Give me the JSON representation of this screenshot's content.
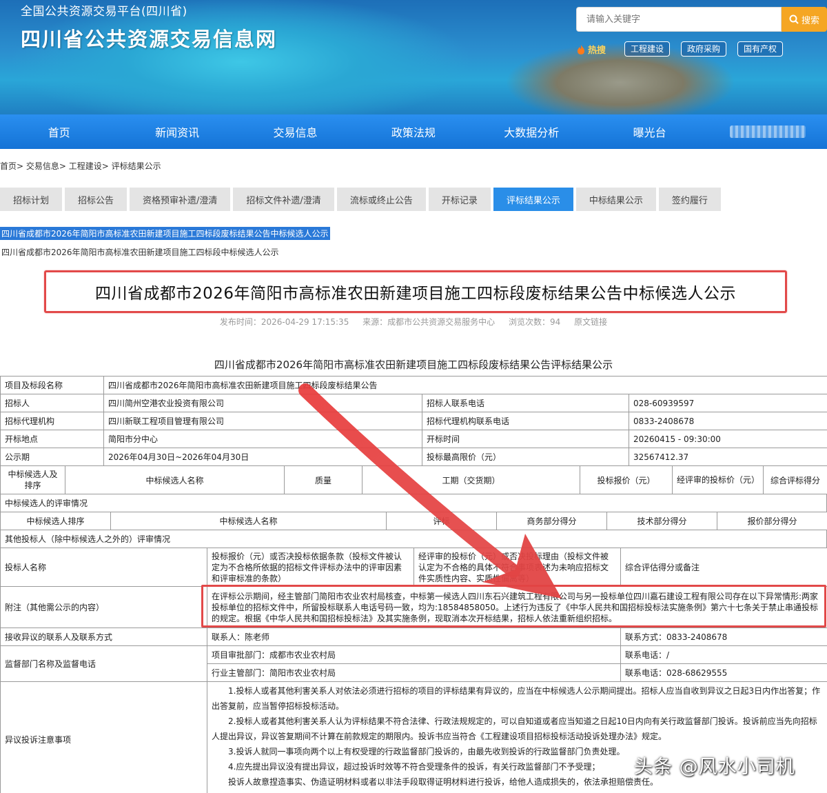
{
  "header": {
    "sub_title": "全国公共资源交易平台(四川省)",
    "site_title": "四川省公共资源交易信息网",
    "search_placeholder": "请输入关键字",
    "search_label": "搜索",
    "hot_label": "热搜",
    "hot_tags": [
      "工程建设",
      "政府采购",
      "国有产权"
    ]
  },
  "nav": [
    "首页",
    "新闻资讯",
    "交易信息",
    "政策法规",
    "大数据分析",
    "曝光台"
  ],
  "breadcrumb": "首页> 交易信息> 工程建设> 评标结果公示",
  "tabs": [
    "招标计划",
    "招标公告",
    "资格预审补遗/澄清",
    "招标文件补遗/澄清",
    "流标或终止公告",
    "开标记录",
    "评标结果公示",
    "中标结果公示",
    "签约履行"
  ],
  "active_tab": "评标结果公示",
  "highlight_title": "四川省成都市2026年简阳市高标准农田新建项目施工四标段废标结果公告中标候选人公示",
  "sub_title": "四川省成都市2026年简阳市高标准农田新建项目施工四标段中标候选人公示",
  "main_title": "四川省成都市2026年简阳市高标准农田新建项目施工四标段废标结果公告中标候选人公示",
  "meta": {
    "publish_time": "发布时间：2026-04-29 17:15:35",
    "source": "来源：成都市公共资源交易服务中心",
    "views": "浏览次数：94",
    "original_link": "原文链接"
  },
  "result_title": "四川省成都市2026年简阳市高标准农田新建项目施工四标段废标结果公告评标结果公示",
  "info": {
    "project_label": "项目及标段名称",
    "project_value": "四川省成都市2026年简阳市高标准农田新建项目施工四标段废标结果公告",
    "tenderer_label": "招标人",
    "tenderer_value": "四川简州空港农业投资有限公司",
    "tenderer_phone_label": "招标人联系电话",
    "tenderer_phone_value": "028-60939597",
    "agency_label": "招标代理机构",
    "agency_value": "四川新联工程项目管理有限公司",
    "agency_phone_label": "招标代理机构联系电话",
    "agency_phone_value": "0833-2408678",
    "open_place_label": "开标地点",
    "open_place_value": "简阳市分中心",
    "open_time_label": "开标时间",
    "open_time_value": "20260415 - 09:30:00",
    "notice_period_label": "公示期",
    "notice_period_value": "2026年04月30日~2026年04月30日",
    "max_price_label": "投标最高限价（元）",
    "max_price_value": "32567412.37"
  },
  "candidate_header": [
    "中标候选人及排序",
    "中标候选人名称",
    "质量",
    "工期（交货期）",
    "投标报价（元）",
    "经评审的投标价（元）",
    "综合评标得分"
  ],
  "review_section": "中标候选人的评审情况",
  "review_header": [
    "中标候选人排序",
    "中标候选人名称",
    "评标",
    "商务部分得分",
    "技术部分得分",
    "报价部分得分"
  ],
  "other_section": "其他投标人（除中标候选人之外的）评审情况",
  "other_header": {
    "name": "投标人名称",
    "price": "投标报价（元）或否决投标依据条款（投标文件被认定为不合格所依据的招标文件评标办法中的评审因素和评审标准的条款）",
    "reason": "经评审的投标价（元）或否决投标理由（投标文件被认定为不合格的具体不符合事项表述为未响应招标文件实质性内容、实质性偏离等）",
    "score": "综合评估得分或备注"
  },
  "notes": {
    "label": "附注（其他需公示的内容）",
    "text": "在评标公示期间，经主管部门简阳市农业农村局核查，中标第一候选人四川东石兴建筑工程有限公司与另一投标单位四川嘉石建设工程有限公司存在以下异常情形:两家投标单位的招标文件中，所留投标联系人电话号码一致，均为:18584858050。上述行为违反了《中华人民共和国招标投标法实施条例》第六十七条关于禁止串通投标的规定。根据《中华人民共和国招标投标法》及其实施条例，现取消本次开标结果，招标人依法重新组织招标。"
  },
  "objection": {
    "label": "接收异议的联系人及联系方式",
    "contact": "联系人：陈老师",
    "phone": "联系方式：0833-2408678"
  },
  "supervision": {
    "label": "监督部门名称及监督电话",
    "approve": "项目审批部门：成都市农业农村局",
    "approve_phone": "联系电话：/",
    "industry": "行业主管部门：简阳市农业农村局",
    "industry_phone": "联系电话：028-68629555"
  },
  "complaint": {
    "label": "异议投诉注意事项",
    "items": [
      "1.投标人或者其他利害关系人对依法必须进行招标的项目的评标结果有异议的，应当在中标候选人公示期间提出。招标人应当自收到异议之日起3日内作出答复；作出答复前，应当暂停招标投标活动。",
      "2.投标人或者其他利害关系人认为评标结果不符合法律、行政法规规定的，可以自知道或者应当知道之日起10日内向有关行政监督部门投诉。投诉前应当先向招标人提出异议，异议答复期间不计算在前款规定的期限内。投诉书应当符合《工程建设项目招标投标活动投诉处理办法》规定。",
      "3.投诉人就同一事项向两个以上有权受理的行政监督部门投诉的，由最先收到投诉的行政监督部门负责处理。",
      "4.应先提出异议没有提出异议，超过投诉时效等不符合受理条件的投诉，有关行政监督部门不予受理；",
      "投诉人故意捏造事实、伪造证明材料或者以非法手段取得证明材料进行投诉，给他人造成损失的，依法承担赔偿责任。"
    ]
  },
  "watermark": "头条 @风水小司机",
  "colors": {
    "nav": "#1a7fe0",
    "active_tab": "#2a8ee8",
    "annotation": "#e24949"
  }
}
